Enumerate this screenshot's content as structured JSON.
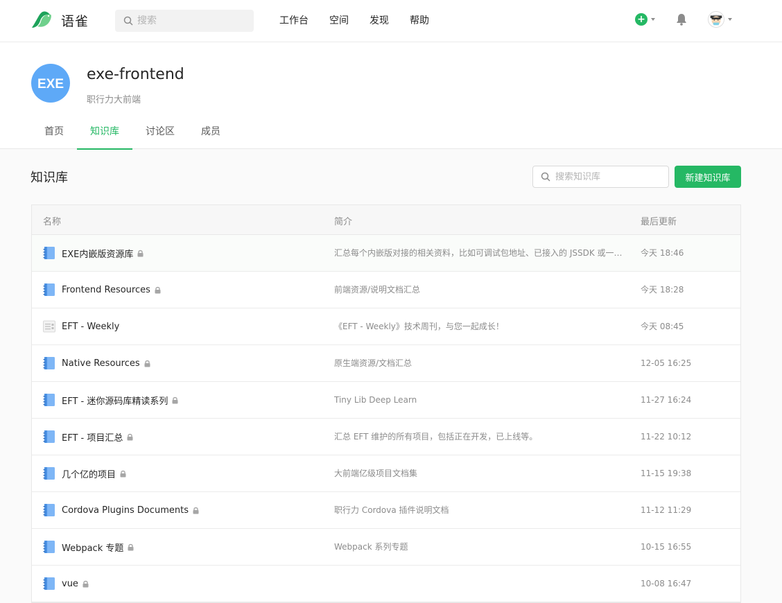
{
  "app": {
    "logo_text": "语雀",
    "search_placeholder": "搜索",
    "nav": [
      "工作台",
      "空间",
      "发现",
      "帮助"
    ]
  },
  "group": {
    "name": "exe-frontend",
    "description": "职行力大前端",
    "logo_text": "EXE",
    "tabs": [
      {
        "label": "首页",
        "active": false
      },
      {
        "label": "知识库",
        "active": true
      },
      {
        "label": "讨论区",
        "active": false
      },
      {
        "label": "成员",
        "active": false
      }
    ]
  },
  "library": {
    "title": "知识库",
    "search_placeholder": "搜索知识库",
    "new_button": "新建知识库",
    "columns": {
      "name": "名称",
      "desc": "简介",
      "updated": "最后更新"
    },
    "rows": [
      {
        "name": "EXE内嵌版资源库",
        "locked": true,
        "icon": "book-icon",
        "desc": "汇总每个内嵌版对接的相关资料，比如可调试包地址、已接入的 JSSDK 或一些注意事项等",
        "updated": "今天 18:46"
      },
      {
        "name": "Frontend Resources",
        "locked": true,
        "icon": "book-icon",
        "desc": "前端资源/说明文档汇总",
        "updated": "今天 18:28"
      },
      {
        "name": "EFT - Weekly",
        "locked": false,
        "icon": "column-icon",
        "desc": "《EFT - Weekly》技术周刊，与您一起成长！",
        "updated": "今天 08:45"
      },
      {
        "name": "Native Resources",
        "locked": true,
        "icon": "book-icon",
        "desc": "原生端资源/文档汇总",
        "updated": "12-05 16:25"
      },
      {
        "name": "EFT - 迷你源码库精读系列",
        "locked": true,
        "icon": "book-icon",
        "desc": "Tiny Lib Deep Learn",
        "updated": "11-27 16:24"
      },
      {
        "name": "EFT - 项目汇总",
        "locked": true,
        "icon": "book-icon",
        "desc": "汇总 EFT 维护的所有项目，包括正在开发，已上线等。",
        "updated": "11-22 10:12"
      },
      {
        "name": "几个亿的项目",
        "locked": true,
        "icon": "book-icon",
        "desc": "大前端亿级项目文档集",
        "updated": "11-15 19:38"
      },
      {
        "name": "Cordova Plugins Documents",
        "locked": true,
        "icon": "book-icon",
        "desc": "职行力 Cordova 插件说明文档",
        "updated": "11-12 11:29"
      },
      {
        "name": "Webpack 专题",
        "locked": true,
        "icon": "book-icon",
        "desc": "Webpack 系列专题",
        "updated": "10-15 16:55"
      },
      {
        "name": "vue",
        "locked": true,
        "icon": "book-icon",
        "desc": "",
        "updated": "10-08 16:47"
      }
    ]
  },
  "colors": {
    "brand": "#25b864",
    "group_logo": "#5ea9f7"
  }
}
